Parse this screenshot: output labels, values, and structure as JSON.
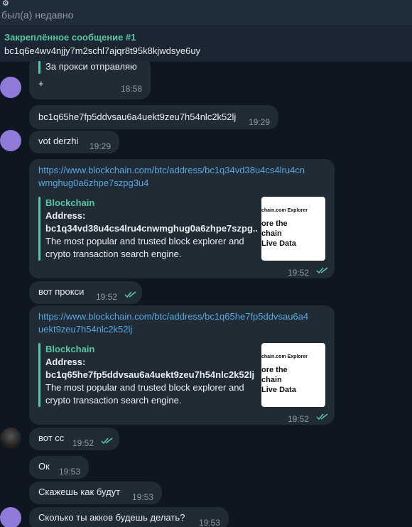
{
  "header": {
    "icon": "cog-icon",
    "status": "был(а) недавно"
  },
  "pinned": {
    "title": "Закреплённое сообщение #1",
    "text": "bc1q6e4wv4njjy7m2schl7ajqr8t95k8kjwdsye6uy"
  },
  "messages": [
    {
      "text": "За прокси отправляю",
      "text2": "+",
      "time": "18:58"
    },
    {
      "text": "bc1q65he7fp5ddvsau6a4uekt9zeu7h54nlc2k52lj",
      "time": "19:29"
    },
    {
      "text": "vot derzhi",
      "time": "19:29"
    },
    {
      "link1": "https://www.blockchain.com/btc/address/bc1q34vd38u4cs4lru4cn",
      "link2": "wmghug0a6zhpe7szpg3u4",
      "preview_title": "Blockchain",
      "preview_addr_label": "Address:",
      "preview_addr": "bc1q34vd38u4cs4lru4cnwmghug0a6zhpe7szpg...",
      "preview_desc1": "The most popular and trusted block explorer and",
      "preview_desc2": "crypto transaction search engine.",
      "thumb_small": "chain.com Explorer",
      "thumb_line1": "ore the",
      "thumb_line2": "chain",
      "thumb_line3": "Live Data",
      "time": "19:52"
    },
    {
      "text": "вот прокси",
      "time": "19:52"
    },
    {
      "link1": "https://www.blockchain.com/btc/address/bc1q65he7fp5ddvsau6a4",
      "link2": "uekt9zeu7h54nlc2k52lj",
      "preview_title": "Blockchain",
      "preview_addr_label": "Address:",
      "preview_addr": "bc1q65he7fp5ddvsau6a4uekt9zeu7h54nlc2k52lj",
      "preview_desc1": "The most popular and trusted block explorer and",
      "preview_desc2": "crypto transaction search engine.",
      "thumb_small": "chain.com Explorer",
      "thumb_line1": "ore the",
      "thumb_line2": "chain",
      "thumb_line3": "Live Data",
      "time": "19:52"
    },
    {
      "text": "вот сс",
      "time": "19:52"
    },
    {
      "text": "Ок",
      "time": "19:53"
    },
    {
      "text": "Скажешь как будут",
      "time": "19:53"
    },
    {
      "text": "Сколько ты акков будешь делать?",
      "time": "19:53"
    }
  ],
  "colors": {
    "accent": "#58c7a4",
    "link": "#5aa8e0",
    "bubble": "#202b36",
    "avatar": "#8f7ad9"
  }
}
